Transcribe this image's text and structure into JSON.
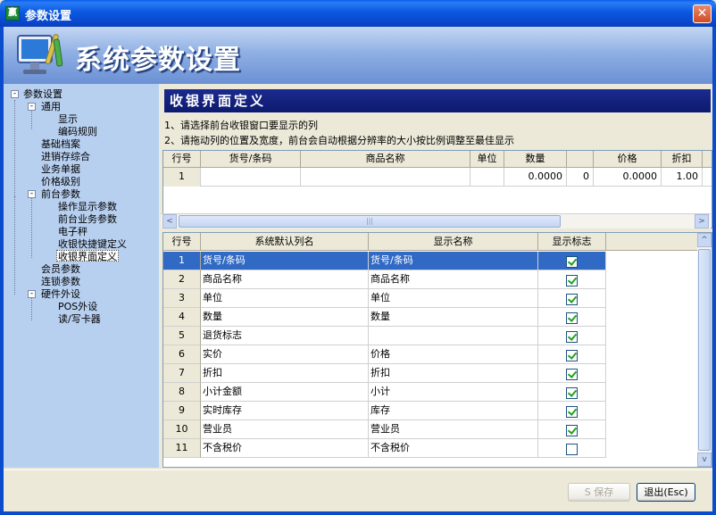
{
  "window": {
    "title": "参数设置",
    "app_icon": "app-logo-icon",
    "close_icon": "close-icon"
  },
  "banner": {
    "title": "系统参数设置",
    "logo_icon": "monitor-tools-icon"
  },
  "tree": {
    "root": "参数设置",
    "general": "通用",
    "display": "显示",
    "coding_rules": "编码规则",
    "basic_files": "基础档案",
    "psi": "进销存综合",
    "business_docs": "业务单据",
    "price_levels": "价格级别",
    "front_params": "前台参数",
    "op_display": "操作显示参数",
    "front_business": "前台业务参数",
    "scale": "电子秤",
    "cashier_shortcuts": "收银快捷键定义",
    "cashier_ui": "收银界面定义",
    "member_params": "会员参数",
    "chain_params": "连锁参数",
    "hardware": "硬件外设",
    "pos_devices": "POS外设",
    "card_reader": "读/写卡器"
  },
  "main": {
    "section_title": "收银界面定义",
    "instruction_1": "1、请选择前台收银窗口要显示的列",
    "instruction_2": "2、请拖动列的位置及宽度，前台会自动根据分辨率的大小按比例调整至最佳显示"
  },
  "preview_grid": {
    "headers": [
      "行号",
      "货号/条码",
      "商品名称",
      "单位",
      "数量",
      "",
      "价格",
      "折扣"
    ],
    "row": [
      "1",
      "",
      "",
      "",
      "0.0000",
      "0",
      "0.0000",
      "1.00"
    ]
  },
  "columns_grid": {
    "headers": [
      "行号",
      "系统默认列名",
      "显示名称",
      "显示标志"
    ],
    "rows": [
      {
        "no": "1",
        "default": "货号/条码",
        "display": "货号/条码",
        "checked": true
      },
      {
        "no": "2",
        "default": "商品名称",
        "display": "商品名称",
        "checked": true
      },
      {
        "no": "3",
        "default": "单位",
        "display": "单位",
        "checked": true
      },
      {
        "no": "4",
        "default": "数量",
        "display": "数量",
        "checked": true
      },
      {
        "no": "5",
        "default": "退货标志",
        "display": "",
        "checked": true
      },
      {
        "no": "6",
        "default": "实价",
        "display": "价格",
        "checked": true
      },
      {
        "no": "7",
        "default": "折扣",
        "display": "折扣",
        "checked": true
      },
      {
        "no": "8",
        "default": "小计金额",
        "display": "小计",
        "checked": true
      },
      {
        "no": "9",
        "default": "实时库存",
        "display": "库存",
        "checked": true
      },
      {
        "no": "10",
        "default": "营业员",
        "display": "营业员",
        "checked": true
      },
      {
        "no": "11",
        "default": "不含税价",
        "display": "不含税价",
        "checked": false
      }
    ]
  },
  "buttons": {
    "save": "S 保存",
    "exit": "退出(Esc)"
  },
  "scroll_glyphs": {
    "left": "<",
    "right": ">",
    "up": "^",
    "down": "v",
    "grip": "|||"
  }
}
